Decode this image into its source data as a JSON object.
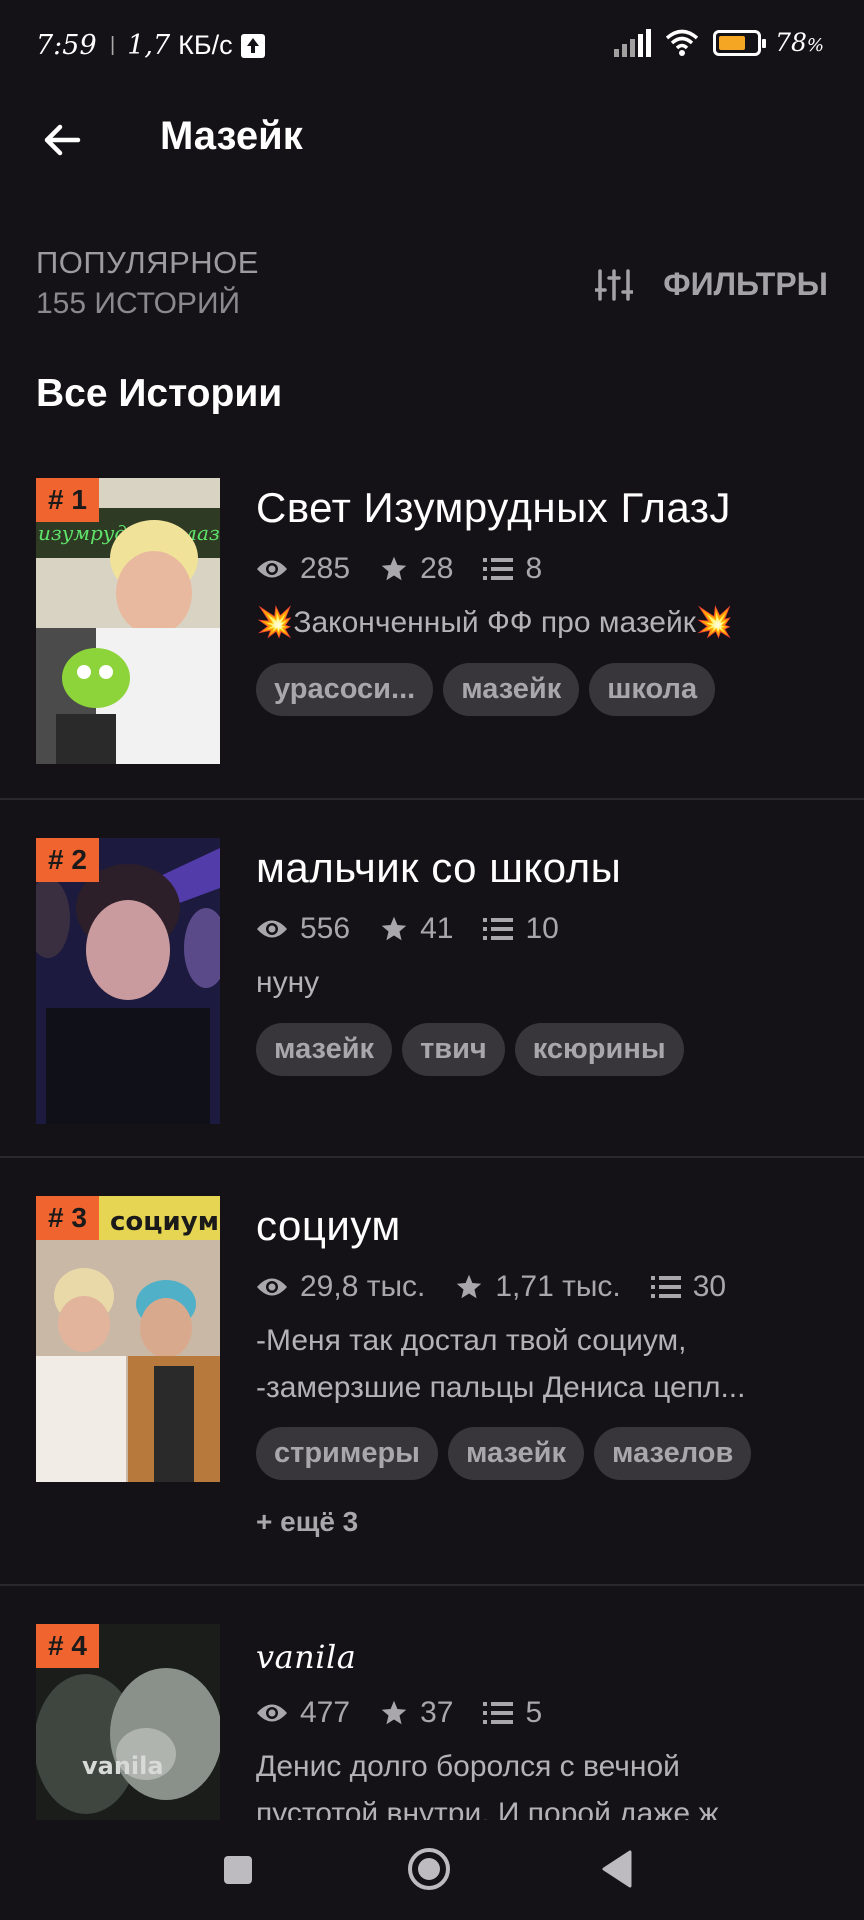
{
  "status_bar": {
    "time": "7:59",
    "speed_value": "1,7",
    "speed_unit": "КБ/с",
    "battery_text": "78",
    "battery_color": "#f5a623"
  },
  "app_bar": {
    "back_icon": "arrow-left-icon",
    "title": "Мазейк"
  },
  "sort": {
    "title": "ПОПУЛЯРНОЕ",
    "count": "155 ИСТОРИЙ"
  },
  "filters": {
    "icon": "sliders-icon",
    "label": "ФИЛЬТРЫ"
  },
  "section_title": "Все Истории",
  "accent_color": "#f0642f",
  "stories": [
    {
      "rank": "# 1",
      "title": "Свет Изумрудных ГлазJ",
      "views": "285",
      "stars": "28",
      "chapters": "8",
      "desc_lines": [
        "💥Законченный ФФ про мазейк💥"
      ],
      "tags": [
        "урасоси...",
        "мазейк",
        "школа"
      ],
      "more": ""
    },
    {
      "rank": "# 2",
      "title": "мальчик со школы",
      "views": "556",
      "stars": "41",
      "chapters": "10",
      "desc_lines": [
        "нуну"
      ],
      "tags": [
        "мазейк",
        "твич",
        "ксюрины"
      ],
      "more": ""
    },
    {
      "rank": "# 3",
      "title": "социум",
      "views": "29,8 тыс.",
      "stars": "1,71 тыс.",
      "chapters": "30",
      "desc_lines": [
        "-Меня так достал твой социум,",
        "-замерзшие пальцы Дениса цепл..."
      ],
      "tags": [
        "стримеры",
        "мазейк",
        "мазелов"
      ],
      "more": "+ ещё 3"
    },
    {
      "rank": "# 4",
      "title": "vanila",
      "views": "477",
      "stars": "37",
      "chapters": "5",
      "desc_lines": [
        "Денис долго боролся с вечной",
        "пустотой внутри. И порой даже ж"
      ],
      "tags": [],
      "more": ""
    }
  ],
  "cover_texts": {
    "story1": "изумрудных глаз",
    "story3": "социум",
    "story4": "vanila"
  },
  "nav": {
    "recent": "square-icon",
    "home": "circle-home-icon",
    "back": "triangle-back-icon"
  }
}
